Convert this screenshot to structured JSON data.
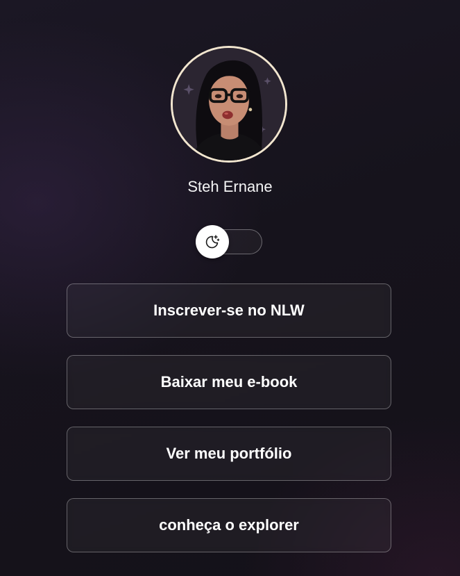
{
  "profile": {
    "name": "Steh Ernane",
    "avatar_icon": "profile-avatar-illustration",
    "avatar_border_color": "#f2e6cf"
  },
  "theme_toggle": {
    "icon": "moon-stars-icon",
    "state": "dark"
  },
  "links": [
    {
      "label": "Inscrever-se no NLW"
    },
    {
      "label": "Baixar meu e-book"
    },
    {
      "label": "Ver meu portfólio"
    },
    {
      "label": "conheça o explorer"
    }
  ],
  "colors": {
    "background": "#16131c",
    "text": "#ffffff",
    "button_border": "rgba(255,255,255,0.32)"
  }
}
